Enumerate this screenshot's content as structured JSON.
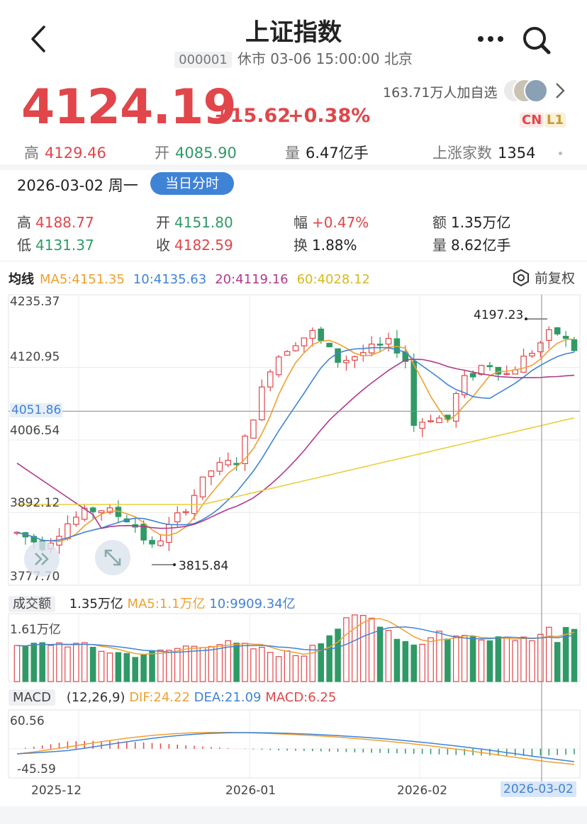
{
  "header": {
    "title": "上证指数",
    "code": "000001",
    "status": "休市 03-06 15:00:00 北京"
  },
  "quote": {
    "price": "4124.19",
    "change": "+15.62",
    "change_pct": "+0.38%",
    "followers": "163.71万人加自选",
    "badge_cn": "CN",
    "badge_l1": "L1"
  },
  "stats": {
    "high_label": "高",
    "high": "4129.46",
    "open_label": "开",
    "open": "4085.90",
    "vol_label": "量",
    "vol": "6.47亿手",
    "up_label": "上涨家数",
    "up": "1354"
  },
  "day": {
    "date": "2026-03-02 周一",
    "intraday_button": "当日分时",
    "high_label": "高",
    "high": "4188.77",
    "open_label": "开",
    "open": "4151.80",
    "amp_label": "幅",
    "amp": "+0.47%",
    "amt_label": "额",
    "amt": "1.35万亿",
    "low_label": "低",
    "low": "4131.37",
    "close_label": "收",
    "close": "4182.59",
    "turn_label": "换",
    "turn": "1.88%",
    "vol_label": "量",
    "vol": "8.62亿手"
  },
  "ma": {
    "title": "均线",
    "ma5": "MA5:4151.35",
    "ma10": "10:4135.63",
    "ma20": "20:4119.16",
    "ma60": "60:4028.12",
    "adjust": "前复权"
  },
  "kline": {
    "y_top": "4235.37",
    "y_mid": "4120.95",
    "y_cross": "4051.86",
    "y_low1": "4006.54",
    "y_low2": "3892.12",
    "y_bottom": "3777.70",
    "max_label": "4197.23",
    "min_label": "3815.84"
  },
  "volume": {
    "title": "成交额",
    "value": "1.35万亿",
    "ma5": "MA5:1.1万亿",
    "ma10": "10:9909.34亿",
    "y_top": "1.61万亿"
  },
  "macd": {
    "title": "MACD",
    "params": "(12,26,9)",
    "dif": "DIF:24.22",
    "dea": "DEA:21.09",
    "macd": "MACD:6.25",
    "y_top": "60.56",
    "y_bottom": "-45.59"
  },
  "xaxis": {
    "t1": "2025-12",
    "t2": "2026-01",
    "t3": "2026-02",
    "selected": "2026-03-02"
  },
  "colors": {
    "up": "#e0464a",
    "down": "#2f9a66",
    "ma5": "#f0a030",
    "ma10": "#3f83d6",
    "ma20": "#b03a8c",
    "ma60": "#e8cf3c"
  }
}
